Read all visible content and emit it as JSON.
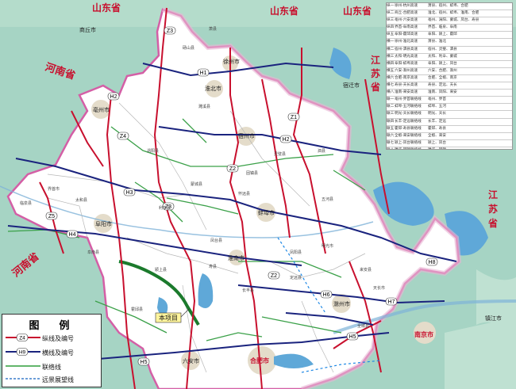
{
  "map": {
    "provinces": {
      "shandong_left": "山东省",
      "shandong_right": "山东省",
      "henan": "河南省",
      "jiangsu_upper": "江苏省",
      "jiangsu_lower": "江苏省",
      "henan_lower": "河南省"
    },
    "cities": [
      "亳州市",
      "宿州市",
      "淮北市",
      "阜阳市",
      "蚌埠市",
      "淮南市",
      "滁州市",
      "合肥市",
      "六安市",
      "南京市",
      "徐州市",
      "宿迁市",
      "商丘市",
      "镇江市"
    ],
    "counties": [
      "萧县",
      "砀山县",
      "濉溪县",
      "涡阳县",
      "蒙城县",
      "利辛县",
      "太和县",
      "界首市",
      "临泉县",
      "颍上县",
      "阜南县",
      "凤台县",
      "寿县",
      "长丰县",
      "定远县",
      "凤阳县",
      "明光市",
      "来安县",
      "天长市",
      "全椒县",
      "灵璧县",
      "泗县",
      "五河县",
      "固镇县",
      "怀远县",
      "蒙城县",
      "霍邱县"
    ],
    "route_codes": [
      "Z1",
      "Z2",
      "Z3",
      "Z4",
      "Z5",
      "H1",
      "H2",
      "H3",
      "H4",
      "H5",
      "H6",
      "H7",
      "H8"
    ],
    "project_label": "本项目"
  },
  "legend": {
    "title": "图　例",
    "items": [
      {
        "code": "Z4",
        "label": "纵线及编号",
        "color": "#c8102e"
      },
      {
        "code": "H9",
        "label": "横线及编号",
        "color": "#1a237e"
      },
      {
        "code": "",
        "label": "联络线",
        "color": "#2e9d3a"
      },
      {
        "code": "",
        "label": "远景展望线",
        "color": "#1565c0"
      }
    ]
  },
  "route_table": [
    {
      "no": "纵一",
      "name": "徐州-杭州高速",
      "via": "萧县、宿州、蚌埠、合肥"
    },
    {
      "no": "纵二",
      "name": "商丘-合肥高速",
      "via": "淮北、宿州、蚌埠、淮南、合肥"
    },
    {
      "no": "纵三",
      "name": "亳州-六安高速",
      "via": "亳州、涡阳、蒙城、凤台、寿县"
    },
    {
      "no": "纵四",
      "name": "界首-阜南高速",
      "via": "界首、临泉、阜南"
    },
    {
      "no": "纵五",
      "name": "阜阳-霍邱高速",
      "via": "阜阳、颍上、霍邱"
    },
    {
      "no": "横一",
      "name": "徐州-淮北高速",
      "via": "萧县、淮北"
    },
    {
      "no": "横二",
      "name": "宿州-泗县高速",
      "via": "宿州、灵璧、泗县"
    },
    {
      "no": "横三",
      "name": "太和-明光高速",
      "via": "太和、利辛、蒙城"
    },
    {
      "no": "横四",
      "name": "阜阳-蚌埠高速",
      "via": "阜阳、颍上、凤台"
    },
    {
      "no": "横五",
      "name": "六安-滁州高速",
      "via": "六安、合肥、滁州"
    },
    {
      "no": "横六",
      "name": "合肥-南京高速",
      "via": "合肥、全椒、南京"
    },
    {
      "no": "横七",
      "name": "寿县-天长高速",
      "via": "寿县、定远、天长"
    },
    {
      "no": "横八",
      "name": "淮南-来安高速",
      "via": "淮南、凤阳、来安"
    },
    {
      "no": "联一",
      "name": "亳州-界首联络线",
      "via": "亳州、界首"
    },
    {
      "no": "联二",
      "name": "蚌埠-五河联络线",
      "via": "蚌埠、五河"
    },
    {
      "no": "联三",
      "name": "明光-天长联络线",
      "via": "明光、天长"
    },
    {
      "no": "联四",
      "name": "长丰-定远联络线",
      "via": "长丰、定远"
    },
    {
      "no": "联五",
      "name": "霍邱-寿县联络线",
      "via": "霍邱、寿县"
    },
    {
      "no": "联六",
      "name": "全椒-来安联络线",
      "via": "全椒、来安"
    },
    {
      "no": "联七",
      "name": "颍上-凤台联络线",
      "via": "颍上、凤台"
    },
    {
      "no": "联八",
      "name": "濉溪-固镇联络线",
      "via": "濉溪、固镇"
    },
    {
      "no": "联九",
      "name": "利辛-颍上联络线",
      "via": "利辛、颍上"
    }
  ]
}
